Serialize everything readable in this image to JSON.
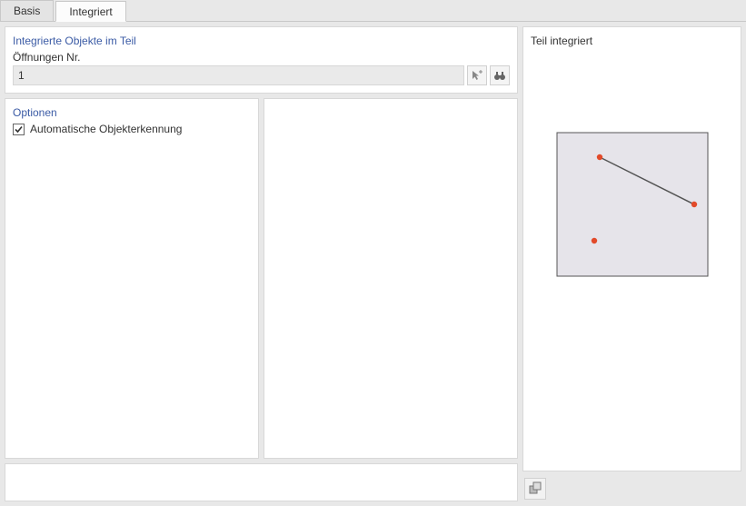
{
  "tabs": {
    "basis": "Basis",
    "integriert": "Integriert"
  },
  "integrated_panel": {
    "title": "Integrierte Objekte im Teil",
    "openings_label": "Öffnungen Nr.",
    "openings_value": "1"
  },
  "options_panel": {
    "title": "Optionen",
    "auto_detect_label": "Automatische Objekterkennung",
    "auto_detect_checked": true
  },
  "preview_panel": {
    "title": "Teil integriert"
  }
}
